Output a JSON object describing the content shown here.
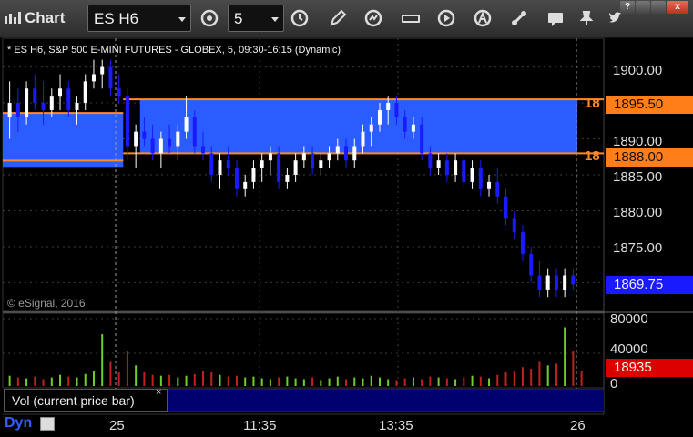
{
  "window": {
    "title": "Chart",
    "help_label": "?",
    "close_label": "x"
  },
  "toolbar": {
    "symbol": "ES H6",
    "interval": "5"
  },
  "chart": {
    "header": "* ES H6, S&P 500 E-MINI FUTURES - GLOBEX, 5, 09:30-16:15 (Dynamic)",
    "watermark": "© eSignal, 2016",
    "price_axis": [
      "1900.00",
      "1895.50",
      "1890.00",
      "1888.00",
      "1885.00",
      "1880.00",
      "1875.00",
      "1869.75"
    ],
    "level_labels": [
      "18",
      "18"
    ],
    "volume_axis": [
      "80000",
      "40000",
      "18935",
      "0"
    ],
    "time_axis": [
      "25",
      "11:35",
      "13:35",
      "26"
    ],
    "volume_study_label": "Vol (current price bar)",
    "volume_close": "×",
    "mode_label": "Dyn",
    "colors": {
      "zone": "#2b5cff",
      "level_line": "#ff8a26",
      "up_candle": "#ffffff",
      "down_candle": "#1a1aff",
      "vol_up": "#6fcf2a",
      "vol_down": "#c0201e"
    }
  },
  "chart_data": {
    "type": "candlestick",
    "symbol": "ES H6",
    "ylim": [
      1866,
      1904
    ],
    "levels": [
      1895.5,
      1888.0
    ],
    "last_price": 1869.75,
    "last_volume": 18935,
    "volume_ylim": [
      0,
      80000
    ],
    "bars": [
      [
        1893,
        1898,
        1890,
        1895
      ],
      [
        1895,
        1897,
        1891,
        1893
      ],
      [
        1893,
        1898,
        1892,
        1897
      ],
      [
        1897,
        1899,
        1894,
        1895
      ],
      [
        1895,
        1898,
        1892,
        1894
      ],
      [
        1894,
        1897,
        1893,
        1896
      ],
      [
        1896,
        1899,
        1894,
        1897
      ],
      [
        1897,
        1898,
        1893,
        1894
      ],
      [
        1894,
        1896,
        1892,
        1895
      ],
      [
        1895,
        1899,
        1894,
        1898
      ],
      [
        1898,
        1901,
        1897,
        1899
      ],
      [
        1899,
        1901,
        1897,
        1900
      ],
      [
        1900,
        1901,
        1896,
        1897
      ],
      [
        1897,
        1899,
        1895,
        1896
      ],
      [
        1896,
        1897,
        1887,
        1889
      ],
      [
        1889,
        1892,
        1886,
        1891
      ],
      [
        1891,
        1893,
        1889,
        1890
      ],
      [
        1890,
        1892,
        1887,
        1888
      ],
      [
        1888,
        1891,
        1886,
        1890
      ],
      [
        1890,
        1892,
        1888,
        1889
      ],
      [
        1889,
        1892,
        1887,
        1891
      ],
      [
        1891,
        1896,
        1890,
        1893
      ],
      [
        1893,
        1894,
        1888,
        1889
      ],
      [
        1889,
        1891,
        1887,
        1888
      ],
      [
        1888,
        1889,
        1884,
        1885
      ],
      [
        1885,
        1888,
        1883,
        1887
      ],
      [
        1887,
        1889,
        1885,
        1886
      ],
      [
        1886,
        1887,
        1882,
        1883
      ],
      [
        1883,
        1885,
        1882,
        1884
      ],
      [
        1884,
        1887,
        1883,
        1886
      ],
      [
        1886,
        1888,
        1884,
        1887
      ],
      [
        1887,
        1889,
        1885,
        1888
      ],
      [
        1888,
        1889,
        1883,
        1884
      ],
      [
        1884,
        1886,
        1883,
        1885
      ],
      [
        1885,
        1888,
        1884,
        1887
      ],
      [
        1887,
        1889,
        1886,
        1888
      ],
      [
        1888,
        1889,
        1885,
        1886
      ],
      [
        1886,
        1888,
        1885,
        1887
      ],
      [
        1887,
        1889,
        1886,
        1888
      ],
      [
        1888,
        1890,
        1887,
        1889
      ],
      [
        1889,
        1890,
        1886,
        1887
      ],
      [
        1887,
        1890,
        1886,
        1889
      ],
      [
        1889,
        1892,
        1888,
        1891
      ],
      [
        1891,
        1893,
        1889,
        1892
      ],
      [
        1892,
        1895,
        1891,
        1894
      ],
      [
        1894,
        1896,
        1892,
        1895
      ],
      [
        1895,
        1896,
        1892,
        1893
      ],
      [
        1893,
        1894,
        1890,
        1891
      ],
      [
        1891,
        1893,
        1890,
        1892
      ],
      [
        1892,
        1893,
        1887,
        1888
      ],
      [
        1888,
        1889,
        1885,
        1886
      ],
      [
        1886,
        1888,
        1885,
        1887
      ],
      [
        1887,
        1888,
        1884,
        1885
      ],
      [
        1885,
        1888,
        1884,
        1887
      ],
      [
        1887,
        1888,
        1883,
        1884
      ],
      [
        1884,
        1887,
        1883,
        1886
      ],
      [
        1886,
        1887,
        1882,
        1883
      ],
      [
        1883,
        1885,
        1882,
        1884
      ],
      [
        1884,
        1886,
        1881,
        1882
      ],
      [
        1882,
        1883,
        1878,
        1879
      ],
      [
        1879,
        1880,
        1876,
        1877
      ],
      [
        1877,
        1878,
        1873,
        1874
      ],
      [
        1874,
        1875,
        1870,
        1871
      ],
      [
        1871,
        1873,
        1868,
        1869
      ],
      [
        1869,
        1872,
        1868,
        1871
      ],
      [
        1871,
        1872,
        1868,
        1869
      ],
      [
        1869,
        1872,
        1868,
        1871
      ],
      [
        1871,
        1872,
        1869,
        1869.75
      ]
    ],
    "volumes": [
      14000,
      12000,
      11000,
      13000,
      10000,
      12000,
      15000,
      13000,
      12000,
      16000,
      20000,
      62000,
      30000,
      18000,
      42000,
      26000,
      18000,
      15000,
      14000,
      15000,
      12000,
      14000,
      16000,
      20000,
      18000,
      15000,
      13000,
      14000,
      12000,
      13000,
      11000,
      10000,
      12000,
      13000,
      11000,
      10000,
      12000,
      9000,
      11000,
      13000,
      10000,
      12000,
      11000,
      14000,
      12000,
      10000,
      9000,
      11000,
      12000,
      10000,
      13000,
      12000,
      11000,
      10000,
      12000,
      14000,
      13000,
      11000,
      15000,
      18000,
      20000,
      24000,
      22000,
      30000,
      26000,
      28000,
      70000,
      42000,
      18935
    ]
  }
}
